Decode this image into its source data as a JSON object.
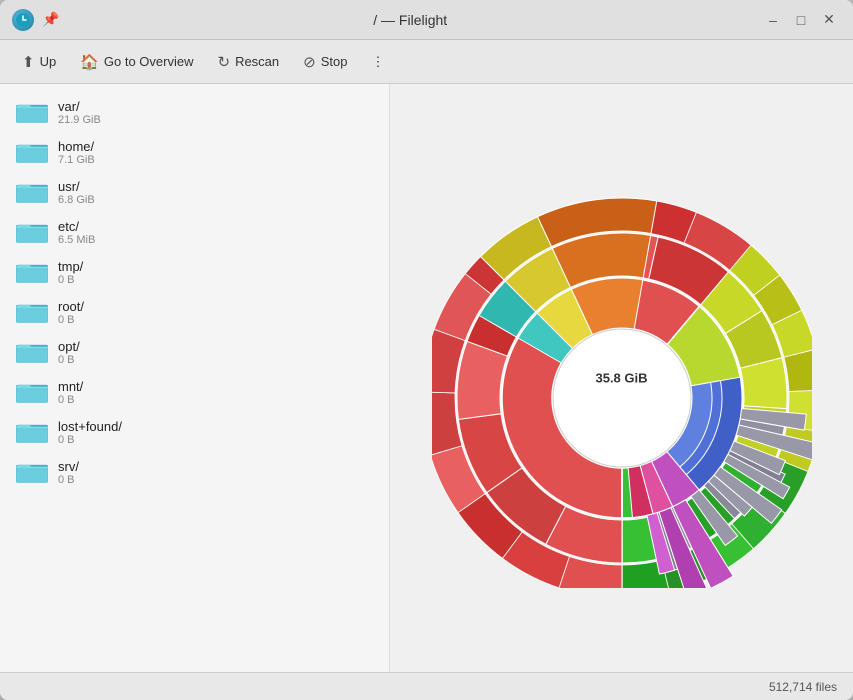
{
  "window": {
    "title": "/ — Filelight",
    "app_icon": "filelight-icon"
  },
  "toolbar": {
    "up_label": "Up",
    "goto_overview_label": "Go to Overview",
    "rescan_label": "Rescan",
    "stop_label": "Stop",
    "more_label": "⋮"
  },
  "window_controls": {
    "minimize_label": "–",
    "maximize_label": "□",
    "close_label": "✕"
  },
  "folders": [
    {
      "name": "var/",
      "size": "21.9 GiB"
    },
    {
      "name": "home/",
      "size": "7.1 GiB"
    },
    {
      "name": "usr/",
      "size": "6.8 GiB"
    },
    {
      "name": "etc/",
      "size": "6.5 MiB"
    },
    {
      "name": "tmp/",
      "size": "0 B"
    },
    {
      "name": "root/",
      "size": "0 B"
    },
    {
      "name": "opt/",
      "size": "0 B"
    },
    {
      "name": "mnt/",
      "size": "0 B"
    },
    {
      "name": "lost+found/",
      "size": "0 B"
    },
    {
      "name": "srv/",
      "size": "0 B"
    }
  ],
  "chart": {
    "center_label": "35.8 GiB",
    "segments": [
      {
        "label": "var",
        "value": 21.9,
        "color": "#e05050"
      },
      {
        "label": "home",
        "value": 7.1,
        "color": "#c8e040"
      },
      {
        "label": "usr",
        "value": 6.8,
        "color": "#40c840"
      },
      {
        "label": "etc",
        "value": 0.0065,
        "color": "#a0a0b0"
      }
    ]
  },
  "status_bar": {
    "file_count": "512,714 files"
  }
}
